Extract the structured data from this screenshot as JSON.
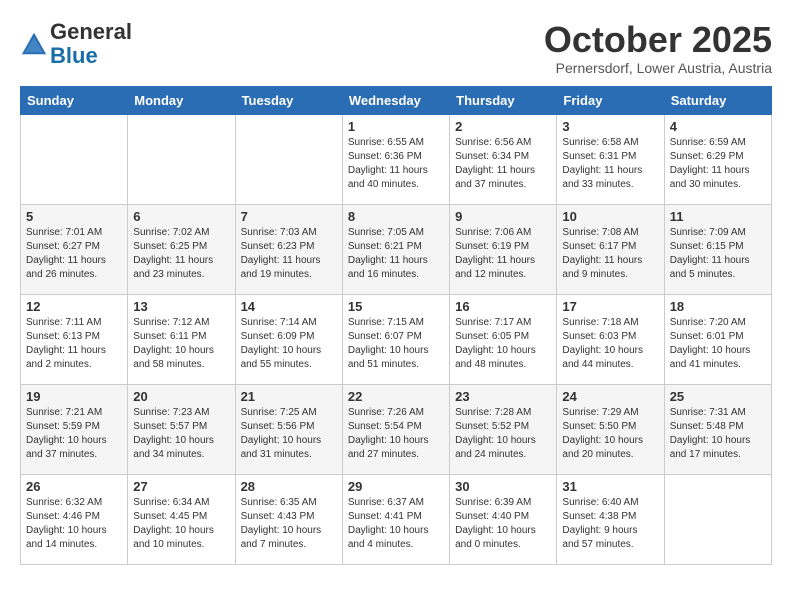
{
  "header": {
    "logo_general": "General",
    "logo_blue": "Blue",
    "month_title": "October 2025",
    "subtitle": "Pernersdorf, Lower Austria, Austria"
  },
  "weekdays": [
    "Sunday",
    "Monday",
    "Tuesday",
    "Wednesday",
    "Thursday",
    "Friday",
    "Saturday"
  ],
  "weeks": [
    [
      {
        "day": "",
        "info": ""
      },
      {
        "day": "",
        "info": ""
      },
      {
        "day": "",
        "info": ""
      },
      {
        "day": "1",
        "info": "Sunrise: 6:55 AM\nSunset: 6:36 PM\nDaylight: 11 hours\nand 40 minutes."
      },
      {
        "day": "2",
        "info": "Sunrise: 6:56 AM\nSunset: 6:34 PM\nDaylight: 11 hours\nand 37 minutes."
      },
      {
        "day": "3",
        "info": "Sunrise: 6:58 AM\nSunset: 6:31 PM\nDaylight: 11 hours\nand 33 minutes."
      },
      {
        "day": "4",
        "info": "Sunrise: 6:59 AM\nSunset: 6:29 PM\nDaylight: 11 hours\nand 30 minutes."
      }
    ],
    [
      {
        "day": "5",
        "info": "Sunrise: 7:01 AM\nSunset: 6:27 PM\nDaylight: 11 hours\nand 26 minutes."
      },
      {
        "day": "6",
        "info": "Sunrise: 7:02 AM\nSunset: 6:25 PM\nDaylight: 11 hours\nand 23 minutes."
      },
      {
        "day": "7",
        "info": "Sunrise: 7:03 AM\nSunset: 6:23 PM\nDaylight: 11 hours\nand 19 minutes."
      },
      {
        "day": "8",
        "info": "Sunrise: 7:05 AM\nSunset: 6:21 PM\nDaylight: 11 hours\nand 16 minutes."
      },
      {
        "day": "9",
        "info": "Sunrise: 7:06 AM\nSunset: 6:19 PM\nDaylight: 11 hours\nand 12 minutes."
      },
      {
        "day": "10",
        "info": "Sunrise: 7:08 AM\nSunset: 6:17 PM\nDaylight: 11 hours\nand 9 minutes."
      },
      {
        "day": "11",
        "info": "Sunrise: 7:09 AM\nSunset: 6:15 PM\nDaylight: 11 hours\nand 5 minutes."
      }
    ],
    [
      {
        "day": "12",
        "info": "Sunrise: 7:11 AM\nSunset: 6:13 PM\nDaylight: 11 hours\nand 2 minutes."
      },
      {
        "day": "13",
        "info": "Sunrise: 7:12 AM\nSunset: 6:11 PM\nDaylight: 10 hours\nand 58 minutes."
      },
      {
        "day": "14",
        "info": "Sunrise: 7:14 AM\nSunset: 6:09 PM\nDaylight: 10 hours\nand 55 minutes."
      },
      {
        "day": "15",
        "info": "Sunrise: 7:15 AM\nSunset: 6:07 PM\nDaylight: 10 hours\nand 51 minutes."
      },
      {
        "day": "16",
        "info": "Sunrise: 7:17 AM\nSunset: 6:05 PM\nDaylight: 10 hours\nand 48 minutes."
      },
      {
        "day": "17",
        "info": "Sunrise: 7:18 AM\nSunset: 6:03 PM\nDaylight: 10 hours\nand 44 minutes."
      },
      {
        "day": "18",
        "info": "Sunrise: 7:20 AM\nSunset: 6:01 PM\nDaylight: 10 hours\nand 41 minutes."
      }
    ],
    [
      {
        "day": "19",
        "info": "Sunrise: 7:21 AM\nSunset: 5:59 PM\nDaylight: 10 hours\nand 37 minutes."
      },
      {
        "day": "20",
        "info": "Sunrise: 7:23 AM\nSunset: 5:57 PM\nDaylight: 10 hours\nand 34 minutes."
      },
      {
        "day": "21",
        "info": "Sunrise: 7:25 AM\nSunset: 5:56 PM\nDaylight: 10 hours\nand 31 minutes."
      },
      {
        "day": "22",
        "info": "Sunrise: 7:26 AM\nSunset: 5:54 PM\nDaylight: 10 hours\nand 27 minutes."
      },
      {
        "day": "23",
        "info": "Sunrise: 7:28 AM\nSunset: 5:52 PM\nDaylight: 10 hours\nand 24 minutes."
      },
      {
        "day": "24",
        "info": "Sunrise: 7:29 AM\nSunset: 5:50 PM\nDaylight: 10 hours\nand 20 minutes."
      },
      {
        "day": "25",
        "info": "Sunrise: 7:31 AM\nSunset: 5:48 PM\nDaylight: 10 hours\nand 17 minutes."
      }
    ],
    [
      {
        "day": "26",
        "info": "Sunrise: 6:32 AM\nSunset: 4:46 PM\nDaylight: 10 hours\nand 14 minutes."
      },
      {
        "day": "27",
        "info": "Sunrise: 6:34 AM\nSunset: 4:45 PM\nDaylight: 10 hours\nand 10 minutes."
      },
      {
        "day": "28",
        "info": "Sunrise: 6:35 AM\nSunset: 4:43 PM\nDaylight: 10 hours\nand 7 minutes."
      },
      {
        "day": "29",
        "info": "Sunrise: 6:37 AM\nSunset: 4:41 PM\nDaylight: 10 hours\nand 4 minutes."
      },
      {
        "day": "30",
        "info": "Sunrise: 6:39 AM\nSunset: 4:40 PM\nDaylight: 10 hours\nand 0 minutes."
      },
      {
        "day": "31",
        "info": "Sunrise: 6:40 AM\nSunset: 4:38 PM\nDaylight: 9 hours\nand 57 minutes."
      },
      {
        "day": "",
        "info": ""
      }
    ]
  ]
}
